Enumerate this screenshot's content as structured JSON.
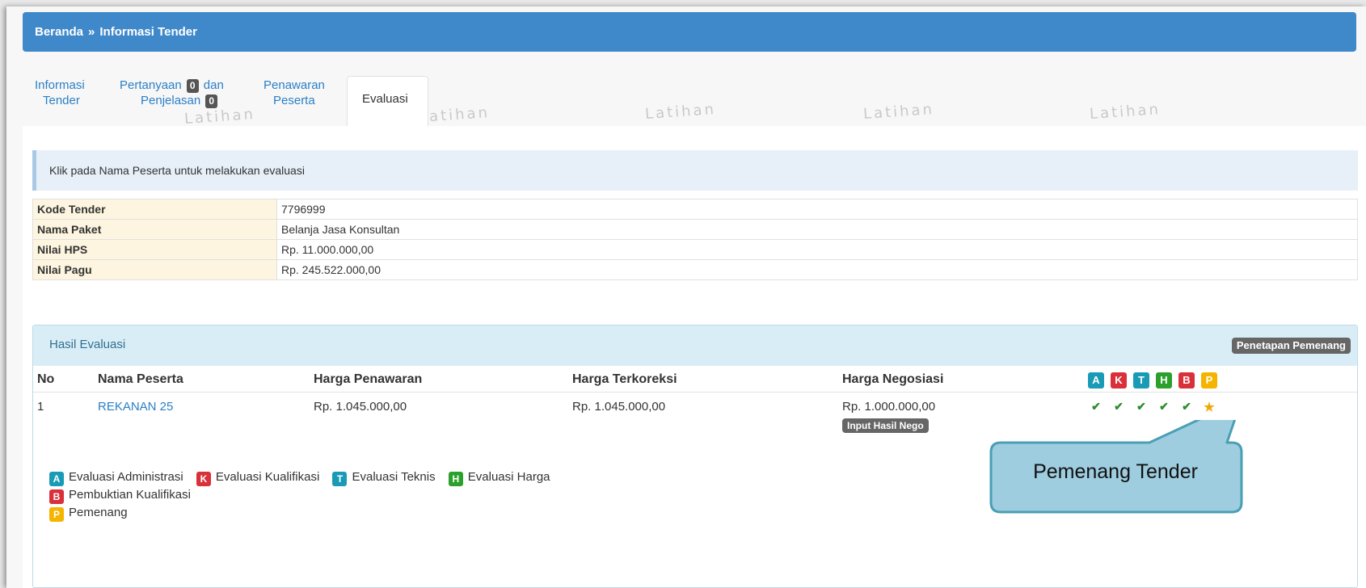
{
  "breadcrumb": {
    "home": "Beranda",
    "separator": "»",
    "current": "Informasi Tender"
  },
  "tabs": [
    {
      "line1": "Informasi",
      "line2": "Tender"
    },
    {
      "line1a": "Pertanyaan",
      "count_questions": "0",
      "line1b": "dan",
      "line2": "Penjelasan",
      "count_answers": "0"
    },
    {
      "line1": "Penawaran",
      "line2": "Peserta"
    },
    {
      "label": "Evaluasi",
      "active": true
    }
  ],
  "watermark": "Latihan",
  "alert": "Klik pada Nama Peserta untuk melakukan evaluasi",
  "tender_info": [
    {
      "label": "Kode Tender",
      "value": "7796999"
    },
    {
      "label": "Nama Paket",
      "value": "Belanja Jasa Konsultan"
    },
    {
      "label": "Nilai HPS",
      "value": "Rp. 11.000.000,00"
    },
    {
      "label": "Nilai Pagu",
      "value": "Rp. 245.522.000,00"
    }
  ],
  "evaluation": {
    "title": "Hasil Evaluasi",
    "winner_button": "Penetapan Pemenang",
    "columns": [
      "No",
      "Nama Peserta",
      "Harga Penawaran",
      "Harga Terkoreksi",
      "Harga Negosiasi"
    ],
    "badges": [
      {
        "letter": "A",
        "color": "#1a9bb5"
      },
      {
        "letter": "K",
        "color": "#d9313a"
      },
      {
        "letter": "T",
        "color": "#1a9bb5"
      },
      {
        "letter": "H",
        "color": "#2ca02c"
      },
      {
        "letter": "B",
        "color": "#d9313a"
      },
      {
        "letter": "P",
        "color": "#f5b400"
      }
    ],
    "rows": [
      {
        "no": "1",
        "name": "REKANAN 25",
        "offer": "Rp. 1.045.000,00",
        "corrected": "Rp. 1.045.000,00",
        "negotiated": "Rp. 1.000.000,00",
        "nego_button": "Input Hasil Nego",
        "marks": [
          "✔",
          "✔",
          "✔",
          "✔",
          "✔",
          "★"
        ]
      }
    ],
    "legend": [
      {
        "letter": "A",
        "text": "Evaluasi Administrasi"
      },
      {
        "letter": "K",
        "text": "Evaluasi Kualifikasi"
      },
      {
        "letter": "T",
        "text": "Evaluasi Teknis"
      },
      {
        "letter": "H",
        "text": "Evaluasi Harga"
      },
      {
        "letter": "B",
        "text": "Pembuktian Kualifikasi"
      },
      {
        "letter": "P",
        "text": "Pemenang"
      }
    ]
  },
  "callout": {
    "text": "Pemenang Tender",
    "fill": "#9ecde0",
    "stroke": "#4a9fb4"
  }
}
